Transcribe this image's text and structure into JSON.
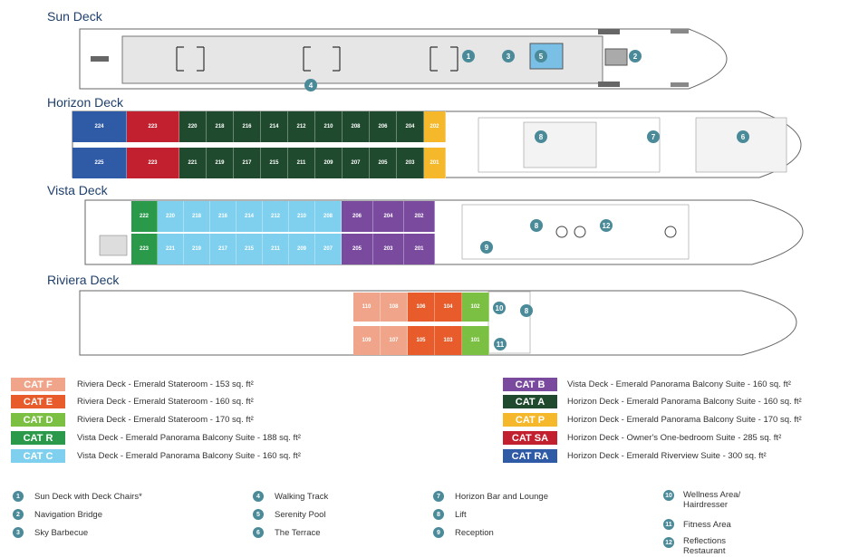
{
  "decks": {
    "sun": "Sun Deck",
    "horizon": "Horizon Deck",
    "vista": "Vista Deck",
    "riviera": "Riviera Deck"
  },
  "colors": {
    "cat_f": "#f0a58a",
    "cat_e": "#e85b2a",
    "cat_d": "#7bbf43",
    "cat_r": "#2a9a4a",
    "cat_c": "#7fd0ee",
    "cat_b": "#7a4a9e",
    "cat_a": "#1f4a2e",
    "cat_p": "#f5b82a",
    "cat_sa": "#c2202e",
    "cat_ra": "#2f5aa6",
    "marker": "#4a8a99"
  },
  "horizon_top": [
    "224",
    "223",
    "220",
    "218",
    "216",
    "214",
    "212",
    "210",
    "208",
    "206",
    "204",
    "202"
  ],
  "horizon_bottom": [
    "225",
    "223",
    "221",
    "219",
    "217",
    "215",
    "211",
    "209",
    "207",
    "205",
    "203",
    "201"
  ],
  "vista_top": [
    "222",
    "220",
    "218",
    "216",
    "214",
    "212",
    "210",
    "208",
    "206",
    "204",
    "202"
  ],
  "vista_bottom": [
    "223",
    "221",
    "219",
    "217",
    "215",
    "211",
    "209",
    "207",
    "205",
    "203",
    "201"
  ],
  "riviera_top": [
    "110",
    "108",
    "106",
    "104",
    "102"
  ],
  "riviera_bottom": [
    "109",
    "107",
    "105",
    "103",
    "101"
  ],
  "markers": {
    "m1": "1",
    "m2": "2",
    "m3": "3",
    "m4": "4",
    "m5": "5",
    "m6": "6",
    "m7": "7",
    "m8": "8",
    "m9": "9",
    "m10": "10",
    "m11": "11",
    "m12": "12"
  },
  "categories": [
    {
      "code": "CAT F",
      "desc": "Riviera Deck - Emerald Stateroom - 153 sq. ft²"
    },
    {
      "code": "CAT E",
      "desc": "Riviera Deck - Emerald Stateroom - 160 sq. ft²"
    },
    {
      "code": "CAT D",
      "desc": "Riviera Deck - Emerald Stateroom - 170 sq. ft²"
    },
    {
      "code": "CAT R",
      "desc": "Vista Deck - Emerald Panorama Balcony Suite - 188 sq. ft²"
    },
    {
      "code": "CAT C",
      "desc": "Vista Deck - Emerald Panorama Balcony Suite - 160 sq. ft²"
    },
    {
      "code": "CAT B",
      "desc": "Vista Deck - Emerald Panorama Balcony Suite - 160 sq. ft²"
    },
    {
      "code": "CAT A",
      "desc": "Horizon Deck - Emerald Panorama Balcony Suite - 160 sq. ft²"
    },
    {
      "code": "CAT P",
      "desc": "Horizon Deck - Emerald Panorama Balcony Suite - 170 sq. ft²"
    },
    {
      "code": "CAT SA",
      "desc": "Horizon Deck - Owner's One-bedroom Suite - 285 sq. ft²"
    },
    {
      "code": "CAT RA",
      "desc": "Horizon Deck - Emerald Riverview Suite - 300 sq. ft²"
    }
  ],
  "features": [
    {
      "num": "1",
      "label": "Sun Deck with Deck Chairs*"
    },
    {
      "num": "2",
      "label": "Navigation Bridge"
    },
    {
      "num": "3",
      "label": "Sky Barbecue"
    },
    {
      "num": "4",
      "label": "Walking Track"
    },
    {
      "num": "5",
      "label": "Serenity Pool"
    },
    {
      "num": "6",
      "label": "The Terrace"
    },
    {
      "num": "7",
      "label": "Horizon Bar and Lounge"
    },
    {
      "num": "8",
      "label": "Lift"
    },
    {
      "num": "9",
      "label": "Reception"
    },
    {
      "num": "10",
      "label": "Wellness Area/ Hairdresser"
    },
    {
      "num": "11",
      "label": "Fitness Area"
    },
    {
      "num": "12",
      "label": "Reflections Restaurant"
    }
  ]
}
